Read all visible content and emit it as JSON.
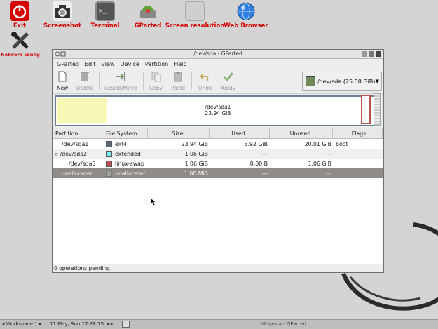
{
  "desktop": {
    "icons": [
      {
        "label": "Exit"
      },
      {
        "label": "Screenshot"
      },
      {
        "label": "Terminal"
      },
      {
        "label": "GParted"
      },
      {
        "label": "Screen resolution"
      },
      {
        "label": "Web Browser"
      },
      {
        "label": "Network config"
      }
    ]
  },
  "window": {
    "title": "/dev/sda - GParted",
    "menu": [
      "GParted",
      "Edit",
      "View",
      "Device",
      "Partition",
      "Help"
    ],
    "toolbar": {
      "new": "New",
      "delete": "Delete",
      "resize": "Resize/Move",
      "copy": "Copy",
      "paste": "Paste",
      "undo": "Undo",
      "apply": "Apply"
    },
    "device_selector": "/dev/sda  (25.00 GiB)",
    "disk_map": {
      "name": "/dev/sda1",
      "size": "23.94 GiB"
    },
    "columns": [
      "Partition",
      "File System",
      "Size",
      "Used",
      "Unused",
      "Flags"
    ],
    "rows": [
      {
        "partition": "/dev/sda1",
        "fs": "ext4",
        "size": "23.94 GiB",
        "used": "3.92 GiB",
        "unused": "20.01 GiB",
        "flags": "boot",
        "color": "#5a6a80"
      },
      {
        "partition": "/dev/sda2",
        "fs": "extended",
        "size": "1.06 GiB",
        "used": "---",
        "unused": "---",
        "flags": "",
        "color": "#7ef3f3"
      },
      {
        "partition": "/dev/sda5",
        "fs": "linux-swap",
        "size": "1.06 GiB",
        "used": "0.00 B",
        "unused": "1.06 GiB",
        "flags": "",
        "color": "#c0504d"
      },
      {
        "partition": "unallocated",
        "fs": "unallocated",
        "size": "1.00 MiB",
        "used": "---",
        "unused": "---",
        "flags": "",
        "color": "#a0a0a0"
      }
    ],
    "status": "0 operations pending"
  },
  "taskbar": {
    "workspace": "◂ Workspace 1 ▸",
    "datetime": "11 May, Sun 17:28:15",
    "window": "/dev/sda - GParted"
  }
}
